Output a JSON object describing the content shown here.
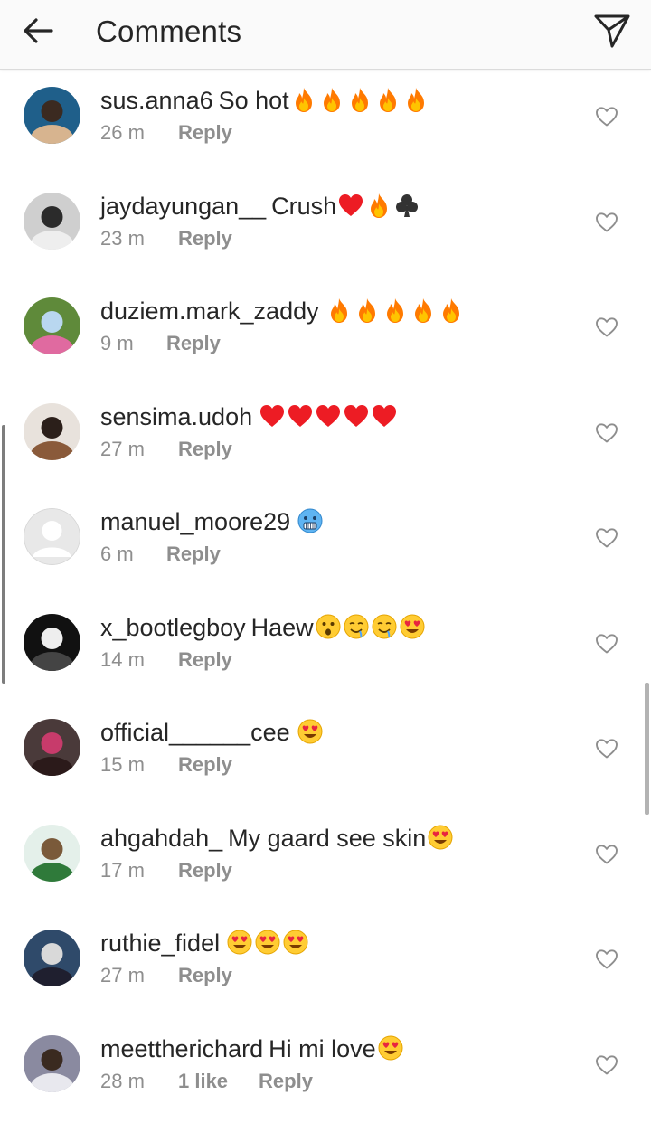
{
  "header": {
    "title": "Comments",
    "back_icon": "arrow-left-icon",
    "send_icon": "paper-plane-icon"
  },
  "colors": {
    "text_primary": "#262626",
    "text_secondary": "#8e8e8e",
    "header_bg": "#fafafa",
    "fire": "#ff7a00",
    "heart_red": "#ed1c24",
    "emoji_yellow": "#ffcc33"
  },
  "comments": [
    {
      "username": "sus.anna6",
      "text": "So hot",
      "emojis": [
        "fire",
        "fire",
        "fire",
        "fire",
        "fire"
      ],
      "time": "26 m",
      "likes": "",
      "reply": "Reply"
    },
    {
      "username": "jaydayungan__",
      "text": "Crush",
      "emojis": [
        "red-heart",
        "fire",
        "club"
      ],
      "time": "23 m",
      "likes": "",
      "reply": "Reply"
    },
    {
      "username": "duziem.mark_zaddy",
      "text": "",
      "emojis": [
        "fire",
        "fire",
        "fire",
        "fire",
        "fire"
      ],
      "time": "9 m",
      "likes": "",
      "reply": "Reply"
    },
    {
      "username": "sensima.udoh",
      "text": "",
      "emojis": [
        "red-heart",
        "red-heart",
        "red-heart",
        "red-heart",
        "red-heart"
      ],
      "time": "27 m",
      "likes": "",
      "reply": "Reply"
    },
    {
      "username": "manuel_moore29",
      "text": "",
      "emojis": [
        "cold-face"
      ],
      "time": "6 m",
      "likes": "",
      "reply": "Reply"
    },
    {
      "username": "x_bootlegboy",
      "text": "Haew",
      "emojis": [
        "hushed-face",
        "drooling-face",
        "drooling-face",
        "heart-eyes"
      ],
      "time": "14 m",
      "likes": "",
      "reply": "Reply"
    },
    {
      "username": "official______cee",
      "text": "",
      "emojis": [
        "heart-eyes"
      ],
      "time": "15 m",
      "likes": "",
      "reply": "Reply"
    },
    {
      "username": "ahgahdah_",
      "text": "My gaard see skin",
      "emojis": [
        "heart-eyes"
      ],
      "time": "17 m",
      "likes": "",
      "reply": "Reply"
    },
    {
      "username": "ruthie_fidel",
      "text": "",
      "emojis": [
        "heart-eyes",
        "heart-eyes",
        "heart-eyes"
      ],
      "time": "27 m",
      "likes": "",
      "reply": "Reply"
    },
    {
      "username": "meettherichard",
      "text": "Hi mi love",
      "emojis": [
        "heart-eyes"
      ],
      "time": "28 m",
      "likes": "1 like",
      "reply": "Reply"
    }
  ]
}
